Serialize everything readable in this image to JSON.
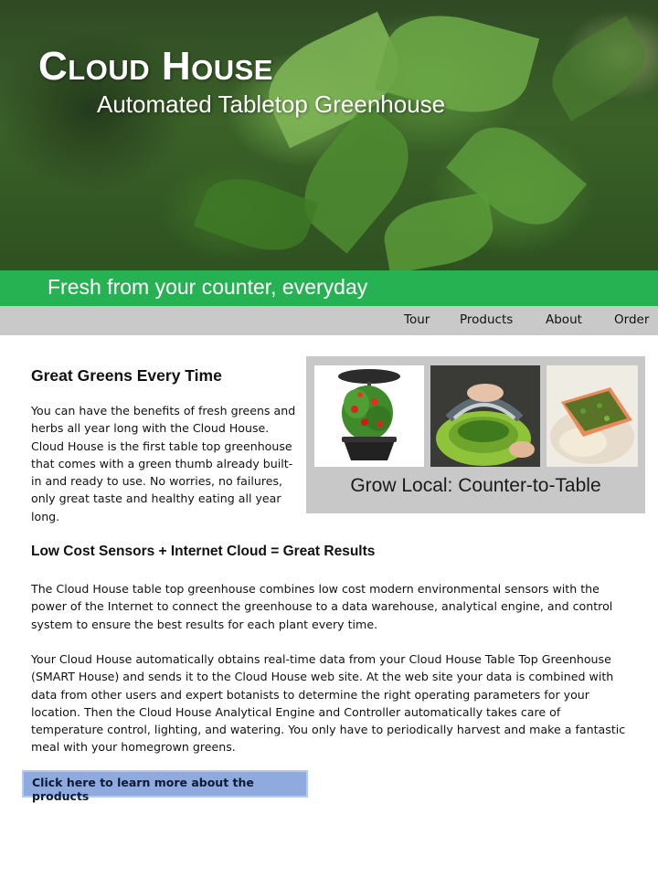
{
  "hero": {
    "title": "Cloud House",
    "subtitle": "Automated Tabletop Greenhouse",
    "image": "basil-leaves-photo"
  },
  "banner": {
    "text": "Fresh from your counter, everyday",
    "color": "#26b153"
  },
  "nav": {
    "items": [
      {
        "label": "Tour"
      },
      {
        "label": "Products"
      },
      {
        "label": "About"
      },
      {
        "label": "Order"
      }
    ]
  },
  "section1": {
    "heading": "Great Greens Every Time",
    "body": "You can have the benefits of fresh greens and herbs all year long with the Cloud House. Cloud House is the first table top greenhouse that comes with a green thumb already built-in and ready to use. No worries, no failures, only great taste and healthy eating all year long."
  },
  "gallery": {
    "caption": "Grow Local: Counter-to-Table",
    "photos": [
      {
        "name": "tomato-planter-photo"
      },
      {
        "name": "herb-chopping-photo"
      },
      {
        "name": "salmon-dish-photo"
      }
    ]
  },
  "section2": {
    "heading": "Low Cost Sensors + Internet Cloud = Great Results",
    "para1": "The Cloud House table top greenhouse combines low cost modern environmental sensors with the power of the Internet to connect the greenhouse to a data warehouse, analytical engine, and control system to ensure the best results for each plant every time.",
    "para2": "Your Cloud House automatically obtains real-time data from your Cloud House Table Top Greenhouse (SMART House) and sends it to the Cloud House web site. At the web site your data is combined with data from other users and expert botanists to determine the right operating parameters for your location.  Then the Cloud House Analytical Engine and Controller automatically takes care of temperature control, lighting, and watering.  You only have to periodically harvest and make a fantastic meal with your homegrown greens."
  },
  "cta": {
    "label": "Click here to learn more about the products",
    "color": "#8eaadf"
  }
}
